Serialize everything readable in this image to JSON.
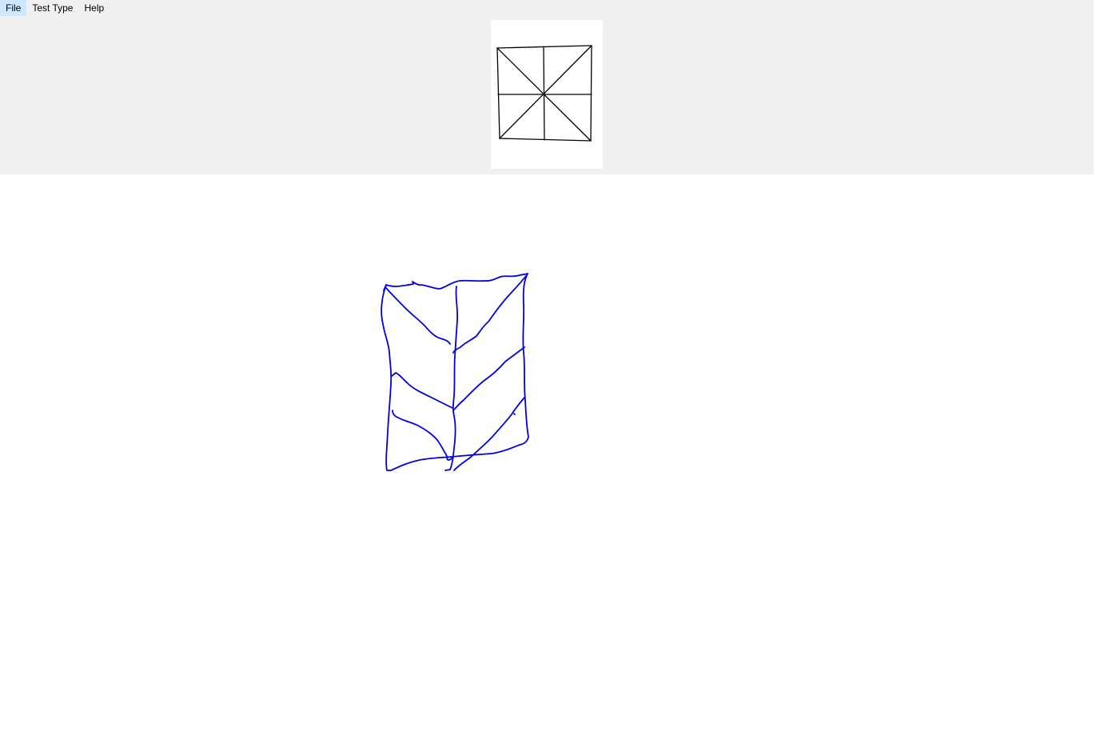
{
  "menu": {
    "file": "File",
    "test_type": "Test Type",
    "help": "Help"
  },
  "reference_figure": {
    "description_icon": "square-with-diagonals-and-cross-icon",
    "stroke_color": "#000000"
  },
  "drawing": {
    "stroke_color": "#0000e0",
    "background_color": "#ffffff"
  },
  "colors": {
    "panel_background": "#f0f0f0",
    "canvas_background": "#ffffff",
    "ink": "#0000e0"
  }
}
